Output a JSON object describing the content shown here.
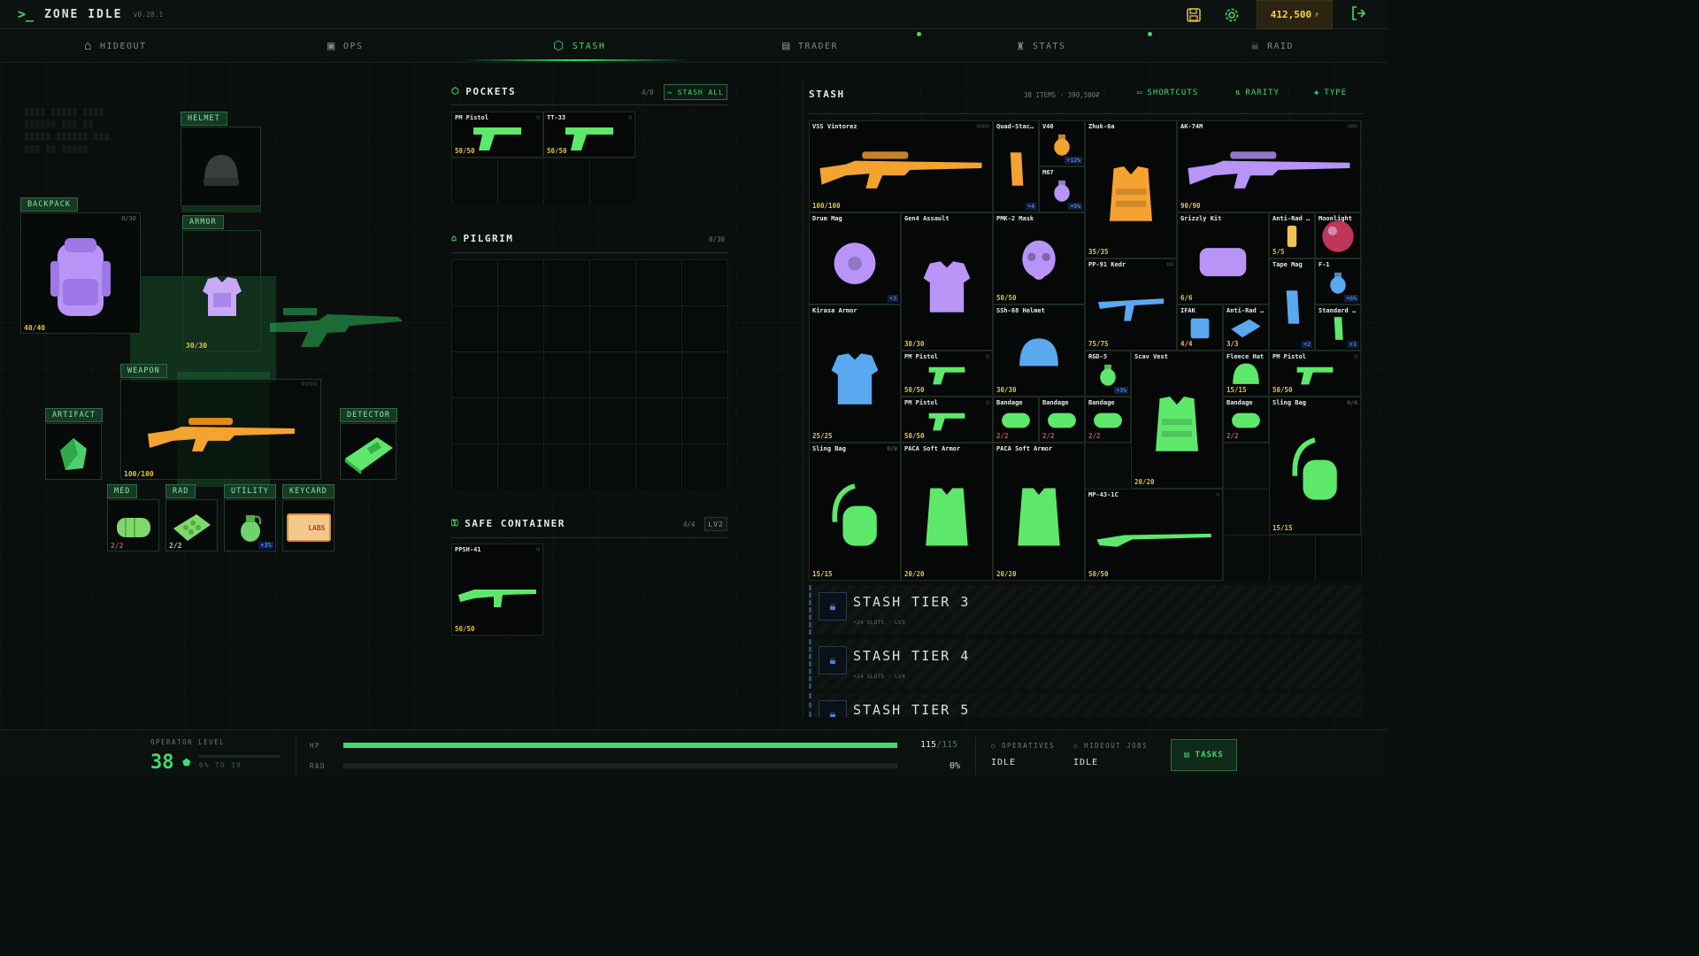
{
  "app": {
    "name": "ZONE IDLE",
    "version": "v0.28.1",
    "money": "412,500",
    "money_unit": "₽"
  },
  "tabs": [
    {
      "label": "HIDEOUT",
      "icon": "home-icon"
    },
    {
      "label": "OPS",
      "icon": "chip-icon"
    },
    {
      "label": "STASH",
      "icon": "box-icon",
      "active": true
    },
    {
      "label": "TRADER",
      "icon": "cart-icon"
    },
    {
      "label": "STATS",
      "icon": "trophy-icon"
    },
    {
      "label": "RAID",
      "icon": "skull-icon"
    }
  ],
  "loadout": {
    "helmet": {
      "label": "HELMET"
    },
    "backpack": {
      "label": "BACKPACK",
      "capacity": "0/30",
      "count": "40/40"
    },
    "armor": {
      "label": "ARMOR",
      "count": "30/30"
    },
    "weapon": {
      "label": "WEAPON",
      "count": "100/100",
      "mod_slots": "○○○○"
    },
    "artifact": {
      "label": "ARTIFACT"
    },
    "detector": {
      "label": "DETECTOR"
    },
    "med": {
      "label": "MED",
      "count": "2/2"
    },
    "rad": {
      "label": "RAD",
      "count": "2/2"
    },
    "utility": {
      "label": "UTILITY",
      "bonus": "+3%"
    },
    "keycard": {
      "label": "KEYCARD",
      "card_text": "LABS"
    }
  },
  "pockets": {
    "title": "POCKETS",
    "capacity": "4/8",
    "action": "STASH ALL",
    "items": [
      {
        "name": "PM Pistol",
        "count": "50/50",
        "ring": "○"
      },
      {
        "name": "TT-33",
        "count": "50/50",
        "ring": "○"
      }
    ]
  },
  "pilgrim": {
    "title": "PILGRIM",
    "capacity": "0/30"
  },
  "safe": {
    "title": "SAFE CONTAINER",
    "capacity": "4/4",
    "level": "LV2",
    "items": [
      {
        "name": "PPSH-41",
        "count": "50/50",
        "ring": "○"
      }
    ]
  },
  "stash": {
    "title": "STASH",
    "meta": "38 ITEMS · 390,500₽",
    "buttons": [
      "SHORTCUTS",
      "RARITY",
      "TYPE"
    ],
    "items": [
      {
        "name": "VSS Vintorez",
        "count": "100/100",
        "ring": "○○○○"
      },
      {
        "name": "Quad-Stack Mag",
        "count": "",
        "bonus": "+4"
      },
      {
        "name": "V40",
        "count": "",
        "bonus": "+12%"
      },
      {
        "name": "M67",
        "count": "",
        "bonus": "+9%"
      },
      {
        "name": "Zhuk-6a",
        "count": "35/35"
      },
      {
        "name": "AK-74M",
        "count": "90/90",
        "ring": "○○○"
      },
      {
        "name": "Drum Mag",
        "count": "",
        "bonus": "+3"
      },
      {
        "name": "Gen4 Assault",
        "count": "30/30"
      },
      {
        "name": "PMK-2 Mask",
        "count": "50/50"
      },
      {
        "name": "Grizzly Kit",
        "count": "6/6"
      },
      {
        "name": "Anti-Rad Injector",
        "count": "5/5"
      },
      {
        "name": "Moonlight",
        "count": ""
      },
      {
        "name": "PP-91 Kedr",
        "count": "75/75",
        "ring": "○○"
      },
      {
        "name": "Tape Mag",
        "count": "",
        "bonus": "+2"
      },
      {
        "name": "F-1",
        "count": "",
        "bonus": "+6%"
      },
      {
        "name": "Kirasa Armor",
        "count": "25/25"
      },
      {
        "name": "SSh-68 Helmet",
        "count": "30/30"
      },
      {
        "name": "IFAK",
        "count": "4/4"
      },
      {
        "name": "Anti-Rad Pack",
        "count": "3/3"
      },
      {
        "name": "Standard Mag",
        "count": "",
        "bonus": "+1"
      },
      {
        "name": "PM Pistol",
        "count": "50/50",
        "ring": "○"
      },
      {
        "name": "RGD-5",
        "count": "",
        "bonus": "+3%"
      },
      {
        "name": "Scav Vest",
        "count": "20/20"
      },
      {
        "name": "Fleece Hat",
        "count": "15/15"
      },
      {
        "name": "PM Pistol",
        "count": "50/50",
        "ring": "○"
      },
      {
        "name": "PM Pistol",
        "count": "50/50",
        "ring": "○"
      },
      {
        "name": "Bandage",
        "count": "2/2"
      },
      {
        "name": "Bandage",
        "count": "2/2"
      },
      {
        "name": "Bandage",
        "count": "2/2"
      },
      {
        "name": "Bandage",
        "count": "2/2"
      },
      {
        "name": "Sling Bag",
        "count": "15/15",
        "cap": "0/8"
      },
      {
        "name": "Sling Bag",
        "count": "15/15",
        "cap": "0/8"
      },
      {
        "name": "PACA Soft Armor",
        "count": "20/20"
      },
      {
        "name": "PACA Soft Armor",
        "count": "20/20"
      },
      {
        "name": "MP-43-1C",
        "count": "50/50",
        "ring": "○"
      }
    ],
    "tiers": [
      {
        "name": "STASH TIER 3",
        "sub": "+24 SLOTS · LV3"
      },
      {
        "name": "STASH TIER 4",
        "sub": "+24 SLOTS · LV4"
      },
      {
        "name": "STASH TIER 5",
        "sub": ""
      }
    ]
  },
  "status": {
    "level_label": "OPERATOR LEVEL",
    "level": "38",
    "level_progress_text": "0% TO 39",
    "level_progress": 0,
    "hp_label": "HP",
    "hp_value": "115",
    "hp_max": "/115",
    "hp_fraction": 1.0,
    "rad_label": "RAD",
    "rad_value": "0%",
    "rad_fraction": 0,
    "operatives_label": "OPERATIVES",
    "operatives_value": "IDLE",
    "hideout_label": "HIDEOUT JOBS",
    "hideout_value": "IDLE",
    "tasks_label": "TASKS"
  },
  "colors": {
    "accent": "#3ddc6e",
    "money": "#ffcf4a",
    "orange": "#f4a230",
    "purple": "#b794f6",
    "blue": "#59a8f0",
    "green": "#5ee86b"
  }
}
